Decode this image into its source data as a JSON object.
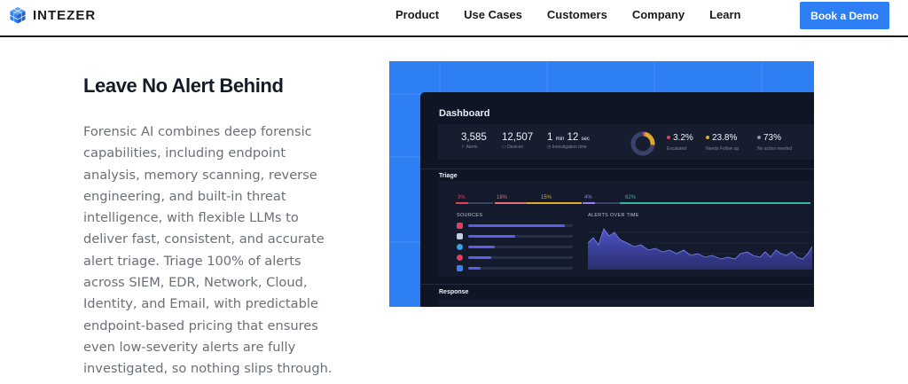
{
  "header": {
    "brand": "INTEZER",
    "nav": [
      "Product",
      "Use Cases",
      "Customers",
      "Company",
      "Learn"
    ],
    "cta_label": "Book a Demo"
  },
  "content": {
    "headline": "Leave No Alert Behind",
    "body": "Forensic AI combines deep forensic capabilities, including endpoint analysis, memory scanning, reverse engineering, and built-in threat intelligence, with flexible LLMs to deliver fast, consistent, and accurate alert triage. Triage 100% of alerts across SIEM, EDR, Network, Cloud, Identity, and Email, with predictable endpoint-based pricing that ensures even low-severity alerts are fully investigated, so nothing slips through."
  },
  "dashboard": {
    "title": "Dashboard",
    "stats": [
      {
        "value": "3,585",
        "label": "Alerts"
      },
      {
        "value": "12,507",
        "label": "Devices"
      },
      {
        "value_min": "1",
        "unit_min": "min",
        "value_sec": "12",
        "unit_sec": "sec",
        "label": "Investigation time"
      }
    ],
    "donut": [
      {
        "fraction": 0.032,
        "color": "#e0405e"
      },
      {
        "fraction": 0.238,
        "color": "#e0a92a"
      },
      {
        "fraction": 0.73,
        "color": "#39426a"
      }
    ],
    "percentages": [
      {
        "value": "3.2%",
        "label": "Escalated",
        "color": "#e0405e"
      },
      {
        "value": "23.8%",
        "label": "Needs Follow up",
        "color": "#e0a92a"
      },
      {
        "value": "73%",
        "label": "No action needed",
        "color": "#8a93a8"
      }
    ],
    "triage_label": "Triage",
    "triage_segments": [
      {
        "label": "3%",
        "color": "#e0405e"
      },
      {
        "label": "16%",
        "color": "#e46a7d"
      },
      {
        "label": "15%",
        "color": "#e0a92a"
      },
      {
        "label": "4%",
        "color": "#9c7bf2"
      },
      {
        "label": "62%",
        "color": "#2fb7a4"
      }
    ],
    "sources_label": "SOURCES",
    "sources": [
      {
        "fraction": 0.92,
        "color": "#e0405e",
        "icon": "alert-source-icon"
      },
      {
        "fraction": 0.45,
        "color": "#c7cde0",
        "icon": "cloud-source-icon"
      },
      {
        "fraction": 0.25,
        "color": "#3aa0e8",
        "icon": "network-source-icon"
      },
      {
        "fraction": 0.22,
        "color": "#e0405e",
        "icon": "identity-source-icon"
      },
      {
        "fraction": 0.12,
        "color": "#3a7ff0",
        "icon": "email-source-icon"
      }
    ],
    "alerts_over_time_label": "ALERTS OVER TIME",
    "response_label": "Response"
  }
}
